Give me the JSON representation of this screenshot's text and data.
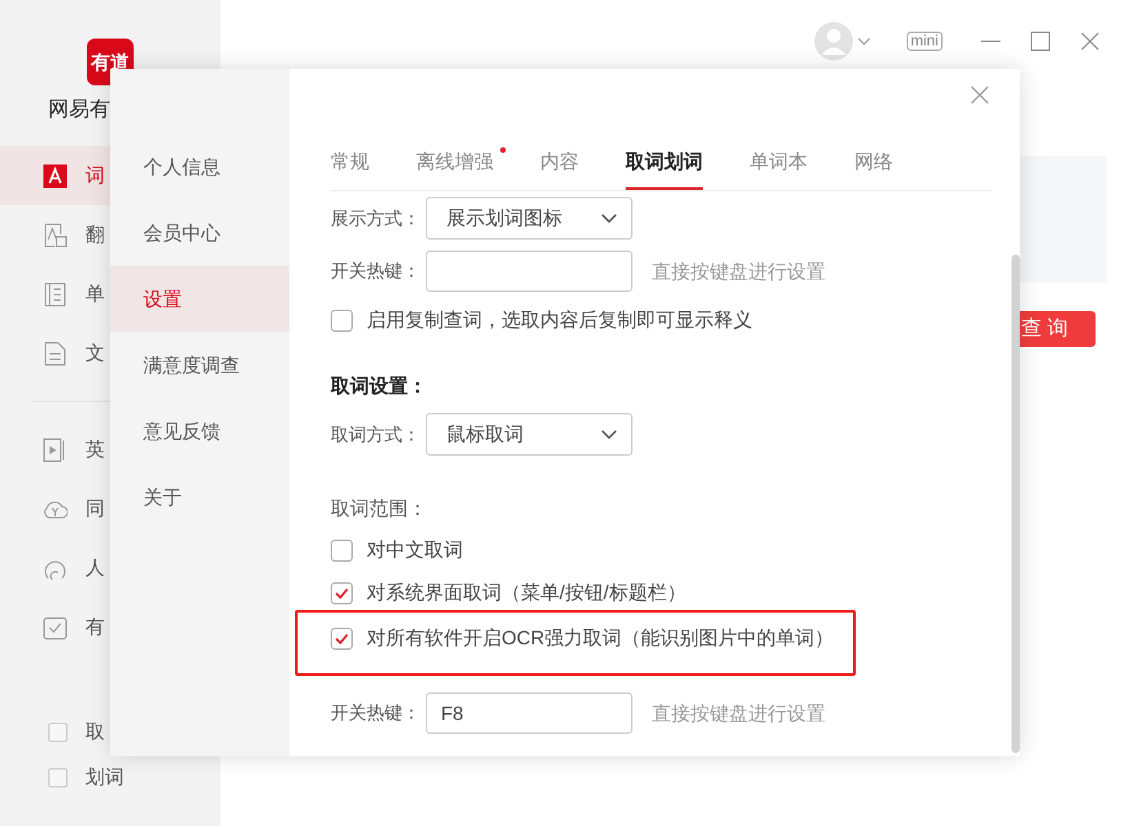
{
  "sidebar": {
    "logo_text": "有道",
    "app_name": "网易有",
    "nav": [
      {
        "label": "词",
        "selected": true
      },
      {
        "label": "翻",
        "selected": false
      },
      {
        "label": "单",
        "selected": false
      },
      {
        "label": "文",
        "selected": false
      },
      {
        "label": "英",
        "selected": false
      },
      {
        "label": "同",
        "selected": false
      },
      {
        "label": "人",
        "selected": false
      },
      {
        "label": "有",
        "selected": false
      }
    ],
    "toggles": [
      {
        "label": "取",
        "checked": false
      },
      {
        "label": "划词",
        "checked": false
      }
    ]
  },
  "topbar": {
    "mini_label": "mini"
  },
  "search_button": "查 询",
  "dialog": {
    "nav": [
      {
        "label": "个人信息",
        "selected": false
      },
      {
        "label": "会员中心",
        "selected": false
      },
      {
        "label": "设置",
        "selected": true
      },
      {
        "label": "满意度调查",
        "selected": false
      },
      {
        "label": "意见反馈",
        "selected": false
      },
      {
        "label": "关于",
        "selected": false
      }
    ],
    "tabs": [
      {
        "label": "常规",
        "selected": false,
        "badge": false
      },
      {
        "label": "离线增强",
        "selected": false,
        "badge": true
      },
      {
        "label": "内容",
        "selected": false,
        "badge": false
      },
      {
        "label": "取词划词",
        "selected": true,
        "badge": false
      },
      {
        "label": "单词本",
        "selected": false,
        "badge": false
      },
      {
        "label": "网络",
        "selected": false,
        "badge": false
      }
    ],
    "settings": [
      {
        "kind": "select",
        "label": "展示方式：",
        "value": "展示划词图标"
      },
      {
        "kind": "hotkey",
        "label": "开关热键：",
        "hint": "直接按键盘进行设置"
      },
      {
        "kind": "checkbox",
        "label": "启用复制查词，选取内容后复制即可显示释义",
        "checked": false,
        "highlighted": false
      },
      {
        "kind": "heading",
        "label": "取词设置："
      },
      {
        "kind": "select",
        "label": "取词方式：",
        "value": "鼠标取词"
      },
      {
        "kind": "label",
        "label": "取词范围："
      },
      {
        "kind": "checkbox",
        "label": "对中文取词",
        "checked": false,
        "highlighted": false
      },
      {
        "kind": "checkbox",
        "label": "对系统界面取词（菜单/按钮/标题栏）",
        "checked": true,
        "highlighted": false
      },
      {
        "kind": "checkbox",
        "label": "对所有软件开启OCR强力取词（能识别图片中的单词）",
        "checked": true,
        "highlighted": true
      },
      {
        "kind": "hotkey",
        "label": "开关热键：",
        "value": "F8",
        "hint": "直接按键盘进行设置"
      }
    ]
  }
}
